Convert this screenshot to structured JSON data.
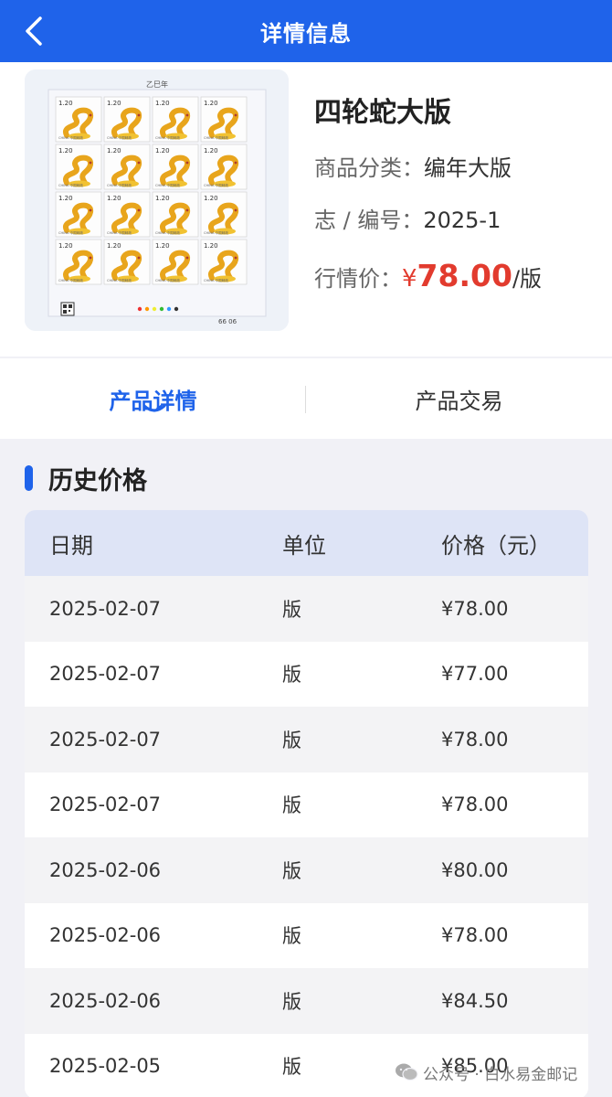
{
  "nav": {
    "title": "详情信息"
  },
  "stamp": {
    "top_text": "乙巳年",
    "denomination": "1.20",
    "country": "CHINA 中国邮政",
    "plate_code": "66 06"
  },
  "product": {
    "name": "四轮蛇大版",
    "category_label": "商品分类：",
    "category_value": "编年大版",
    "code_label": "志 / 编号：",
    "code_value": "2025-1",
    "price_label": "行情价：",
    "price_currency": "¥",
    "price_value": "78.00",
    "price_unit": "/版"
  },
  "tabs": [
    {
      "label": "产品详情",
      "active": true
    },
    {
      "label": "产品交易",
      "active": false
    }
  ],
  "history": {
    "title": "历史价格",
    "headers": [
      "日期",
      "单位",
      "价格（元）"
    ],
    "rows": [
      [
        "2025-02-07",
        "版",
        "¥78.00"
      ],
      [
        "2025-02-07",
        "版",
        "¥77.00"
      ],
      [
        "2025-02-07",
        "版",
        "¥78.00"
      ],
      [
        "2025-02-07",
        "版",
        "¥78.00"
      ],
      [
        "2025-02-06",
        "版",
        "¥80.00"
      ],
      [
        "2025-02-06",
        "版",
        "¥78.00"
      ],
      [
        "2025-02-06",
        "版",
        "¥84.50"
      ],
      [
        "2025-02-05",
        "版",
        "¥85.00"
      ]
    ]
  },
  "watermark": {
    "text": "公众号 · 白水易金邮记"
  },
  "colors": {
    "accent": "#1f63ea",
    "price": "#e23b2e",
    "table_header": "#dee4f6"
  }
}
